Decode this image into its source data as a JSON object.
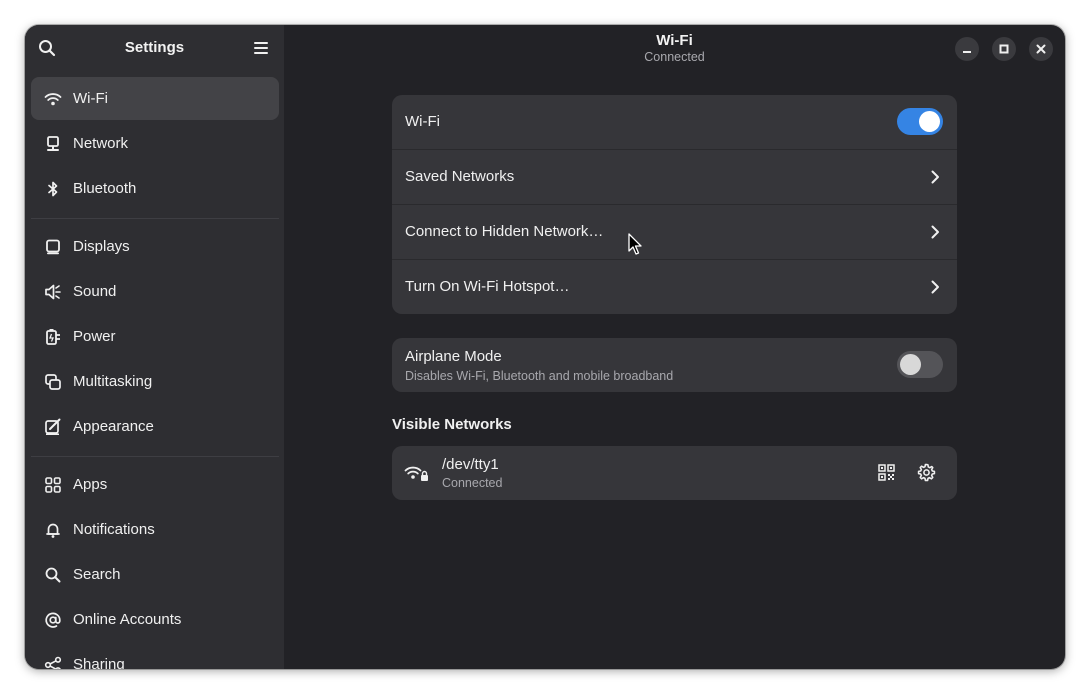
{
  "sidebar": {
    "title": "Settings",
    "items": [
      {
        "label": "Wi-Fi",
        "icon": "wifi-icon"
      },
      {
        "label": "Network",
        "icon": "network-icon"
      },
      {
        "label": "Bluetooth",
        "icon": "bluetooth-icon"
      },
      {
        "label": "Displays",
        "icon": "display-icon"
      },
      {
        "label": "Sound",
        "icon": "speaker-icon"
      },
      {
        "label": "Power",
        "icon": "power-icon"
      },
      {
        "label": "Multitasking",
        "icon": "multitasking-icon"
      },
      {
        "label": "Appearance",
        "icon": "appearance-icon"
      },
      {
        "label": "Apps",
        "icon": "apps-grid-icon"
      },
      {
        "label": "Notifications",
        "icon": "bell-icon"
      },
      {
        "label": "Search",
        "icon": "search-icon"
      },
      {
        "label": "Online Accounts",
        "icon": "at-sign-icon"
      },
      {
        "label": "Sharing",
        "icon": "share-icon"
      }
    ],
    "active": "Wi-Fi"
  },
  "header": {
    "title": "Wi-Fi",
    "subtitle": "Connected"
  },
  "wifi_card": {
    "wifi_label": "Wi-Fi",
    "wifi_enabled": true,
    "saved_networks": "Saved Networks",
    "hidden_network": "Connect to Hidden Network…",
    "hotspot": "Turn On Wi-Fi Hotspot…"
  },
  "airplane": {
    "label": "Airplane Mode",
    "description": "Disables Wi-Fi, Bluetooth and mobile broadband",
    "enabled": false
  },
  "visible_networks": {
    "title": "Visible Networks",
    "networks": [
      {
        "name": "/dev/tty1",
        "status": "Connected",
        "secured": true
      }
    ]
  },
  "colors": {
    "accent": "#3584e4",
    "window_bg": "#222226",
    "sidebar_bg": "#2e2e32",
    "card_bg": "#36363a"
  }
}
